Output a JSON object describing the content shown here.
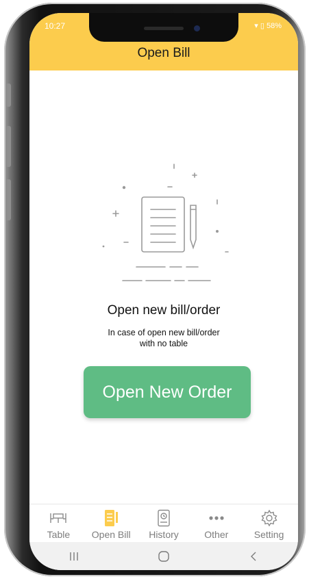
{
  "status_bar": {
    "time": "10:27",
    "right": "▾ ▯ 58%"
  },
  "app_bar": {
    "title": "Open Bill",
    "color": "#fccc4d"
  },
  "empty_state": {
    "illustration_icon": "document-with-pencil-icon",
    "title": "Open new bill/order",
    "subtitle_line1": "In case of open new bill/order",
    "subtitle_line2": "with no table"
  },
  "cta": {
    "label": "Open New Order",
    "color": "#5fbc84"
  },
  "bottom_nav": {
    "active": "Open Bill",
    "active_color": "#fccc4d",
    "items": [
      {
        "label": "Table",
        "icon": "table-icon"
      },
      {
        "label": "Open Bill",
        "icon": "bill-icon"
      },
      {
        "label": "History",
        "icon": "history-icon"
      },
      {
        "label": "Other",
        "icon": "more-icon"
      },
      {
        "label": "Setting",
        "icon": "gear-icon"
      }
    ]
  },
  "system_nav": {
    "buttons": [
      "recent-apps-icon",
      "home-icon",
      "back-icon"
    ]
  }
}
